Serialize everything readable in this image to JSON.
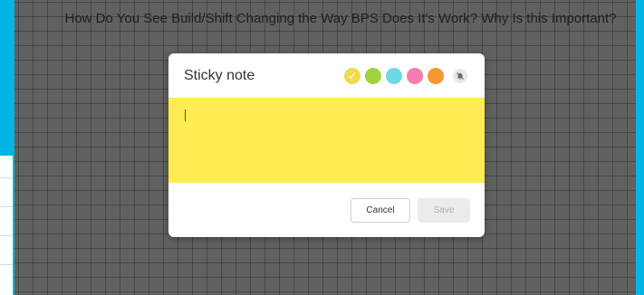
{
  "board": {
    "title": "How Do You See Build/Shift Changing the Way BPS Does It's Work? Why Is this Important?"
  },
  "dialog": {
    "title": "Sticky note",
    "colors": [
      {
        "name": "yellow",
        "hex": "#f2d94e",
        "selected": true
      },
      {
        "name": "green",
        "hex": "#9ed43c",
        "selected": false
      },
      {
        "name": "cyan",
        "hex": "#6fd8e6",
        "selected": false
      },
      {
        "name": "pink",
        "hex": "#f57bb0",
        "selected": false
      },
      {
        "name": "orange",
        "hex": "#f5982e",
        "selected": false
      }
    ],
    "note_color": "#ffeb52",
    "note_text": "",
    "cancel_label": "Cancel",
    "save_label": "Save"
  },
  "colors": {
    "frame": "#00b4e6",
    "board": "#616161"
  }
}
